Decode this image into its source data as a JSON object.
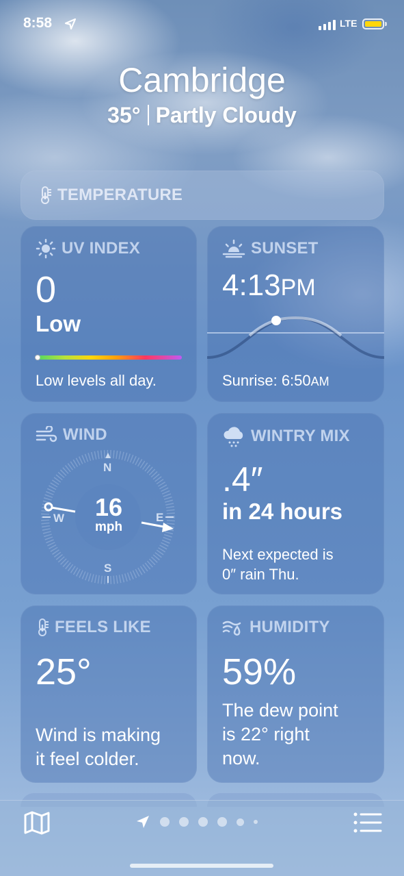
{
  "status_bar": {
    "time": "8:58",
    "network": "LTE"
  },
  "header": {
    "city": "Cambridge",
    "temperature": "35°",
    "condition": "Partly Cloudy"
  },
  "temperature_strip": {
    "label": "TEMPERATURE"
  },
  "cards": {
    "uv": {
      "label": "UV INDEX",
      "value": "0",
      "level": "Low",
      "description": "Low levels all day.",
      "level_fraction": 0
    },
    "sunset": {
      "label": "SUNSET",
      "time": "4:13",
      "ampm": "PM",
      "sunrise_label": "Sunrise: 6:50",
      "sunrise_ampm": "AM"
    },
    "wind": {
      "label": "WIND",
      "speed": "16",
      "unit": "mph",
      "north": "N",
      "south": "S",
      "east": "E",
      "west": "W"
    },
    "wintry_mix": {
      "label": "WINTRY MIX",
      "amount": ".4″",
      "period": "in 24 hours",
      "description_line1": "Next expected is",
      "description_line2": "0″ rain Thu."
    },
    "feels_like": {
      "label": "FEELS LIKE",
      "value": "25°",
      "description_line1": "Wind is making",
      "description_line2": "it feel colder."
    },
    "humidity": {
      "label": "HUMIDITY",
      "value": "59%",
      "description_line1": "The dew point",
      "description_line2": "is 22° right",
      "description_line3": "now."
    }
  },
  "tab_bar": {
    "pages": 6,
    "current_page": 0
  },
  "colors": {
    "battery": "#ffd60a",
    "card_label": "#dce8fa",
    "background": "#6a93c9"
  }
}
